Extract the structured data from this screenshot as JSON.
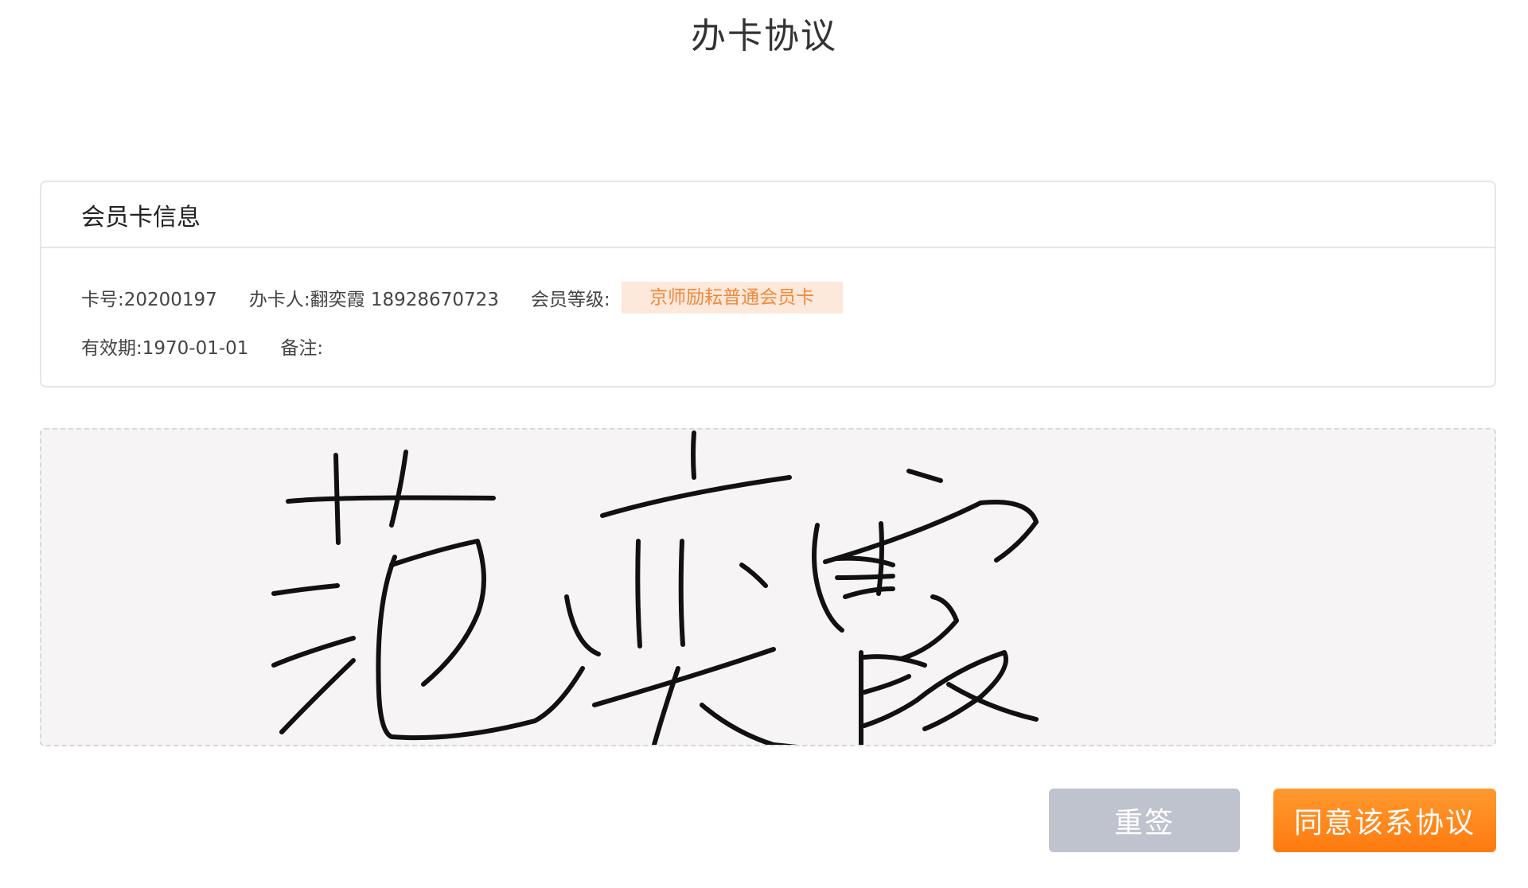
{
  "header": {
    "title": "办卡协议"
  },
  "card_info": {
    "title": "会员卡信息",
    "card_no": "卡号:20200197",
    "applicant": "办卡人:翻奕霞 18928670723",
    "level_label": "会员等级:",
    "level_value": "京师励耘普通会员卡",
    "valid_until": "有效期:1970-01-01",
    "remark": "备注:"
  },
  "actions": {
    "resign_label": "重签",
    "agree_label": "同意该系协议"
  },
  "colors": {
    "accent": "#ff8a1f",
    "badge_bg": "#fde8dc",
    "badge_text": "#f08a3a",
    "secondary_button": "#bfc3ce",
    "pad_bg": "#f7f4f6"
  }
}
